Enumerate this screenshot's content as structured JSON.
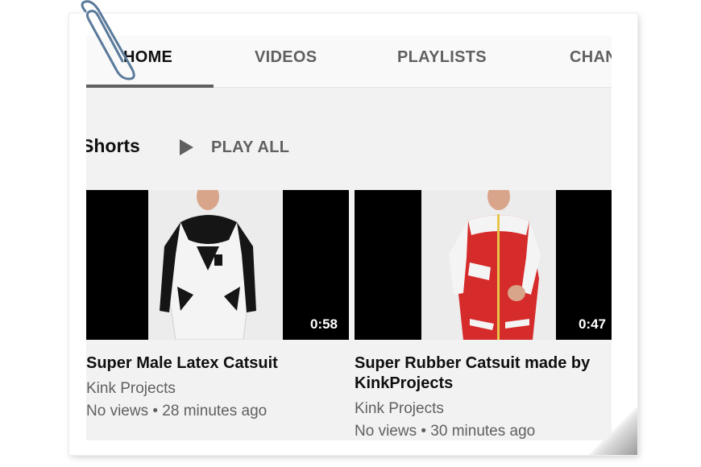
{
  "tabs": [
    {
      "label": "HOME",
      "active": true
    },
    {
      "label": "VIDEOS",
      "active": false
    },
    {
      "label": "PLAYLISTS",
      "active": false
    },
    {
      "label": "CHAN",
      "active": false
    }
  ],
  "shelf": {
    "title": "Shorts",
    "play_all_label": "PLAY ALL",
    "play_icon": "play-icon"
  },
  "videos": [
    {
      "title": "Super Male Latex Catsuit",
      "channel": "Kink Projects",
      "meta": "No views • 28 minutes ago",
      "duration": "0:58"
    },
    {
      "title": "Super Rubber Catsuit made by KinkProjects",
      "channel": "Kink Projects",
      "meta": "No views • 30 minutes ago",
      "duration": "0:47"
    }
  ],
  "colors": {
    "background": "#f2f2f2",
    "tabbar": "#f9f9f9",
    "text_primary": "#0f0f0f",
    "text_secondary": "#606060"
  }
}
